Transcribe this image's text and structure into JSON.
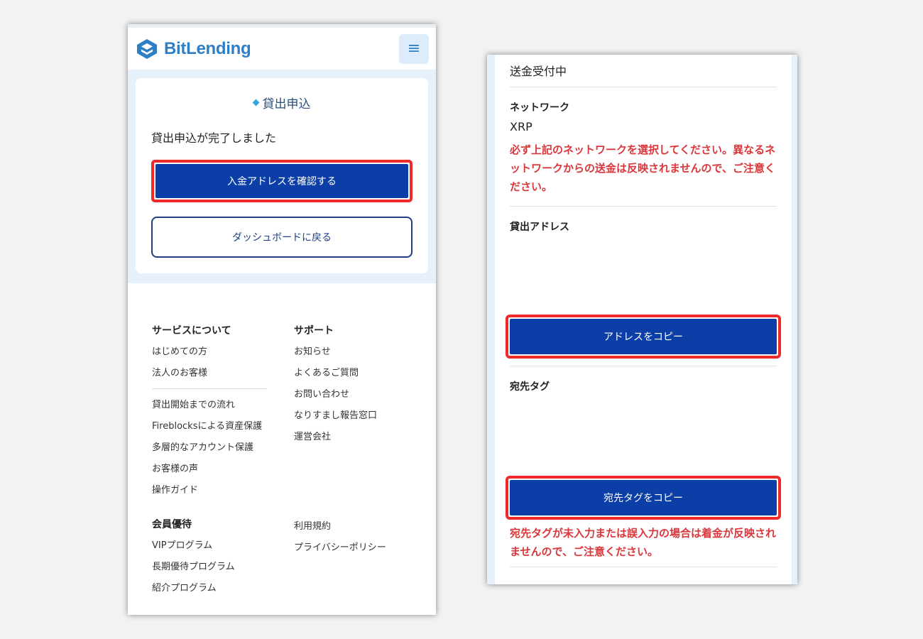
{
  "left": {
    "brand": "BitLending",
    "menu_icon": "≡",
    "panel": {
      "title": "貸出申込",
      "message": "貸出申込が完了しました",
      "primary_button": "入金アドレスを確認する",
      "secondary_button": "ダッシュボードに戻る"
    },
    "footer": {
      "col1_heading": "サービスについて",
      "col1_links_a": [
        "はじめての方",
        "法人のお客様"
      ],
      "col1_links_b": [
        "貸出開始までの流れ",
        "Fireblocksによる資産保護",
        "多層的なアカウント保護",
        "お客様の声",
        "操作ガイド"
      ],
      "col2_heading": "サポート",
      "col2_links": [
        "お知らせ",
        "よくあるご質問",
        "お問い合わせ",
        "なりすまし報告窓口",
        "運営会社"
      ],
      "col3_heading": "会員優待",
      "col3_links": [
        "VIPプログラム",
        "長期優待プログラム",
        "紹介プログラム"
      ],
      "col4_links": [
        "利用規約",
        "プライバシーポリシー"
      ]
    }
  },
  "right": {
    "status": "送金受付中",
    "network_label": "ネットワーク",
    "network_value": "XRP",
    "network_warning": "必ず上記のネットワークを選択してください。異なるネットワークからの送金は反映されませんので、ご注意ください。",
    "address_label": "貸出アドレス",
    "copy_address_button": "アドレスをコピー",
    "tag_label": "宛先タグ",
    "copy_tag_button": "宛先タグをコピー",
    "tag_warning": "宛先タグが未入力または誤入力の場合は着金が反映されませんので、ご注意ください。"
  },
  "colors": {
    "primary_button": "#0b3fa7",
    "highlight_border": "#ee2a2a",
    "warning_text": "#d9373b",
    "brand_blue": "#2f7fc6"
  }
}
